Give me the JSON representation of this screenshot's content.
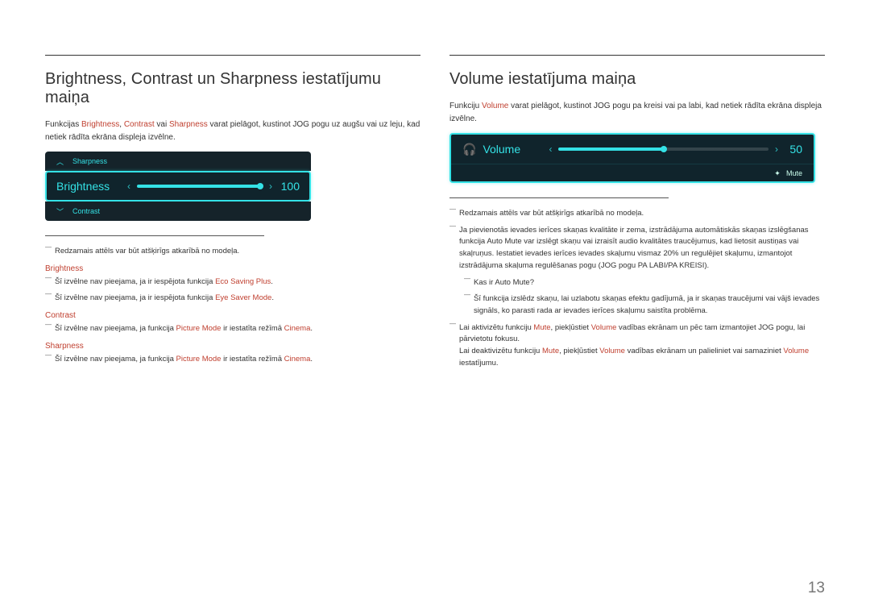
{
  "page_number": "13",
  "left": {
    "title": "Brightness, Contrast un Sharpness iestatījumu maiņa",
    "intro_pre": "Funkcijas ",
    "intro_t1": "Brightness",
    "intro_c1": ", ",
    "intro_t2": "Contrast",
    "intro_c2": " vai ",
    "intro_t3": "Sharpness",
    "intro_post": " varat pielāgot, kustinot JOG pogu uz augšu vai uz leju, kad netiek rādīta ekrāna displeja izvēlne.",
    "osd_up_label": "Sharpness",
    "osd_main_label": "Brightness",
    "osd_main_value": "100",
    "osd_down_label": "Contrast",
    "note_model": "Redzamais attēls var būt atšķirīgs atkarībā no modeļa.",
    "h_brightness": "Brightness",
    "b1_pre": "Šī izvēlne nav pieejama, ja ir iespējota funkcija ",
    "b1_term": "Eco Saving Plus",
    "b1_post": ".",
    "b2_pre": "Šī izvēlne nav pieejama, ja ir iespējota funkcija ",
    "b2_term": "Eye Saver Mode",
    "b2_post": ".",
    "h_contrast": "Contrast",
    "c1_pre": "Šī izvēlne nav pieejama, ja funkcija ",
    "c1_term1": "Picture Mode",
    "c1_mid": " ir iestatīta režīmā ",
    "c1_term2": "Cinema",
    "c1_post": ".",
    "h_sharpness": "Sharpness",
    "s1_pre": "Šī izvēlne nav pieejama, ja funkcija ",
    "s1_term1": "Picture Mode",
    "s1_mid": " ir iestatīta režīmā ",
    "s1_term2": "Cinema",
    "s1_post": "."
  },
  "right": {
    "title": "Volume iestatījuma maiņa",
    "intro_pre": "Funkciju ",
    "intro_term": "Volume",
    "intro_post": " varat pielāgot, kustinot JOG pogu pa kreisi vai pa labi, kad netiek rādīta ekrāna displeja izvēlne.",
    "osd_label": "Volume",
    "osd_value": "50",
    "osd_mute": "Mute",
    "note_model": "Redzamais attēls var būt atšķirīgs atkarībā no modeļa.",
    "note2": "Ja pievienotās ievades ierīces skaņas kvalitāte ir zema, izstrādājuma automātiskās skaņas izslēgšanas funkcija Auto Mute var izslēgt skaņu vai izraisīt audio kvalitātes traucējumus, kad lietosit austiņas vai skaļruņus. Iestatiet ievades ierīces ievades skaļumu vismaz 20% un regulējiet skaļumu, izmantojot izstrādājuma skaļuma regulēšanas pogu (JOG pogu PA LABI/PA KREISI).",
    "note2_sub1": "Kas ir Auto Mute?",
    "note2_sub2": "Šī funkcija izslēdz skaņu, lai uzlabotu skaņas efektu gadījumā, ja ir skaņas traucējumi vai vājš ievades signāls, ko parasti rada ar ievades ierīces skaļumu saistīta problēma.",
    "note3_pre": "Lai aktivizētu funkciju ",
    "note3_t1": "Mute",
    "note3_mid1": ", piekļūstiet ",
    "note3_t2": "Volume",
    "note3_mid2": " vadības ekrānam un pēc tam izmantojiet JOG pogu, lai pārvietotu fokusu.",
    "note3_line2_pre": "Lai deaktivizētu funkciju ",
    "note3_line2_t1": "Mute",
    "note3_line2_mid1": ", piekļūstiet ",
    "note3_line2_t2": "Volume",
    "note3_line2_mid2": " vadības ekrānam un palieliniet vai samaziniet ",
    "note3_line2_t3": "Volume",
    "note3_line2_post": " iestatījumu."
  }
}
